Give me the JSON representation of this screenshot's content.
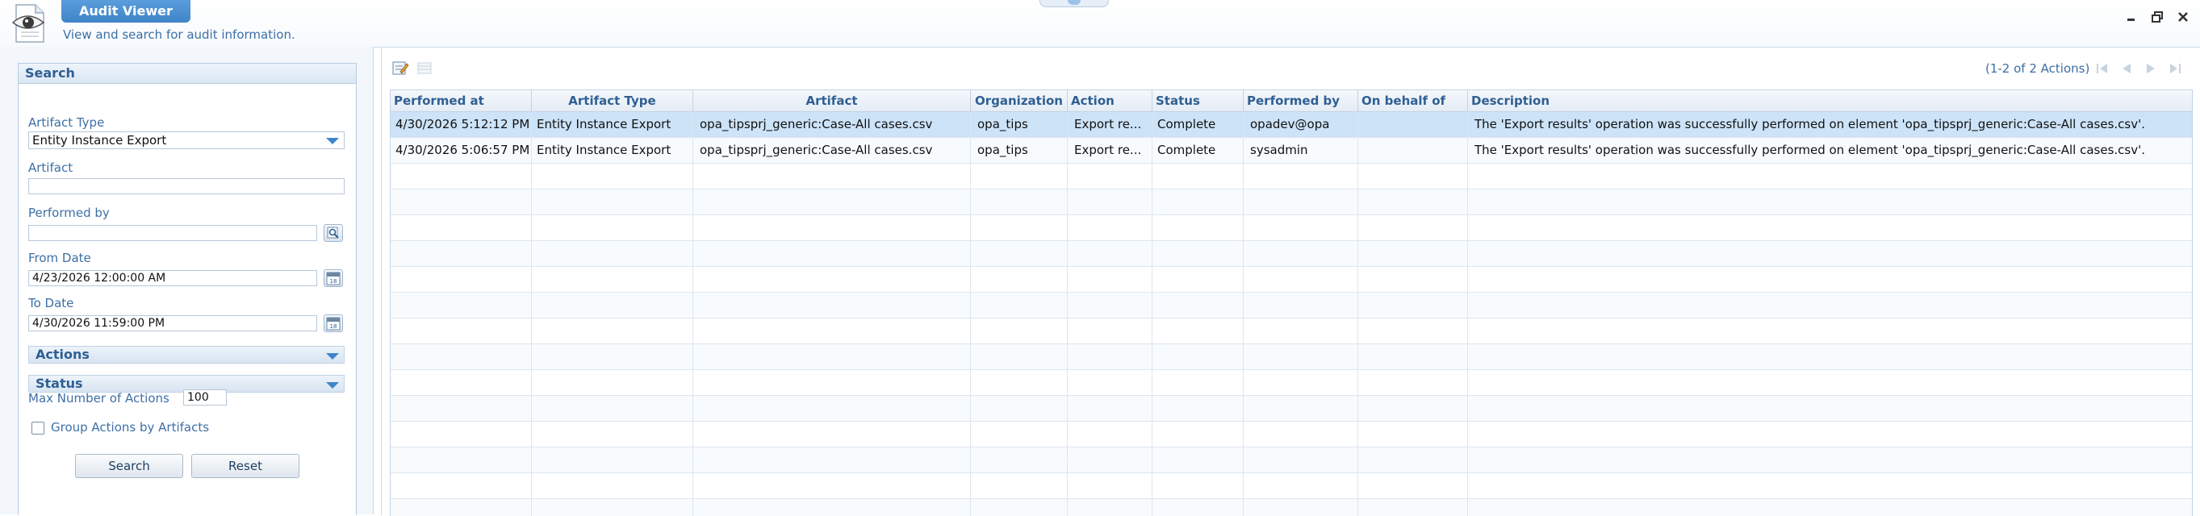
{
  "app": {
    "title": "Audit Viewer",
    "subtitle": "View and search for audit information."
  },
  "search": {
    "header": "Search",
    "artifact_type_label": "Artifact Type",
    "artifact_type_value": "Entity Instance Export",
    "artifact_label": "Artifact",
    "artifact_value": "",
    "performed_by_label": "Performed by",
    "performed_by_value": "",
    "from_date_label": "From Date",
    "from_date_value": "4/23/2026 12:00:00 AM",
    "to_date_label": "To Date",
    "to_date_value": "4/30/2026 11:59:00 PM",
    "actions_section": "Actions",
    "status_section": "Status",
    "max_actions_label": "Max Number of Actions",
    "max_actions_value": "100",
    "group_by_label": "Group Actions by Artifacts",
    "group_by_checked": false,
    "search_button": "Search",
    "reset_button": "Reset"
  },
  "grid": {
    "paging": "(1-2 of 2 Actions)",
    "columns": [
      "Performed at",
      "Artifact Type",
      "Artifact",
      "Organization",
      "Action",
      "Status",
      "Performed by",
      "On behalf of",
      "Description"
    ],
    "rows": [
      [
        "4/30/2026 5:12:12 PM",
        "Entity Instance Export",
        "opa_tipsprj_generic:Case-All cases.csv",
        "opa_tips",
        "Export re...",
        "Complete",
        "opadev@opa",
        "",
        "The 'Export results' operation was successfully performed on element 'opa_tipsprj_generic:Case-All cases.csv'."
      ],
      [
        "4/30/2026 5:06:57 PM",
        "Entity Instance Export",
        "opa_tipsprj_generic:Case-All cases.csv",
        "opa_tips",
        "Export re...",
        "Complete",
        "sysadmin",
        "",
        "The 'Export results' operation was successfully performed on element 'opa_tipsprj_generic:Case-All cases.csv'."
      ]
    ]
  },
  "icons": {
    "app_logo": "eye-document-icon",
    "minimize": "minimize-icon",
    "restore": "restore-icon",
    "close": "close-icon",
    "edit_view": "edit-view-icon",
    "columns": "columns-icon",
    "first_page": "first-page-icon",
    "prev_page": "prev-page-icon",
    "next_page": "next-page-icon",
    "last_page": "last-page-icon"
  },
  "colors": {
    "accent": "#3f84c8",
    "label": "#3d6fa6",
    "selected_row": "#cde3f8"
  }
}
